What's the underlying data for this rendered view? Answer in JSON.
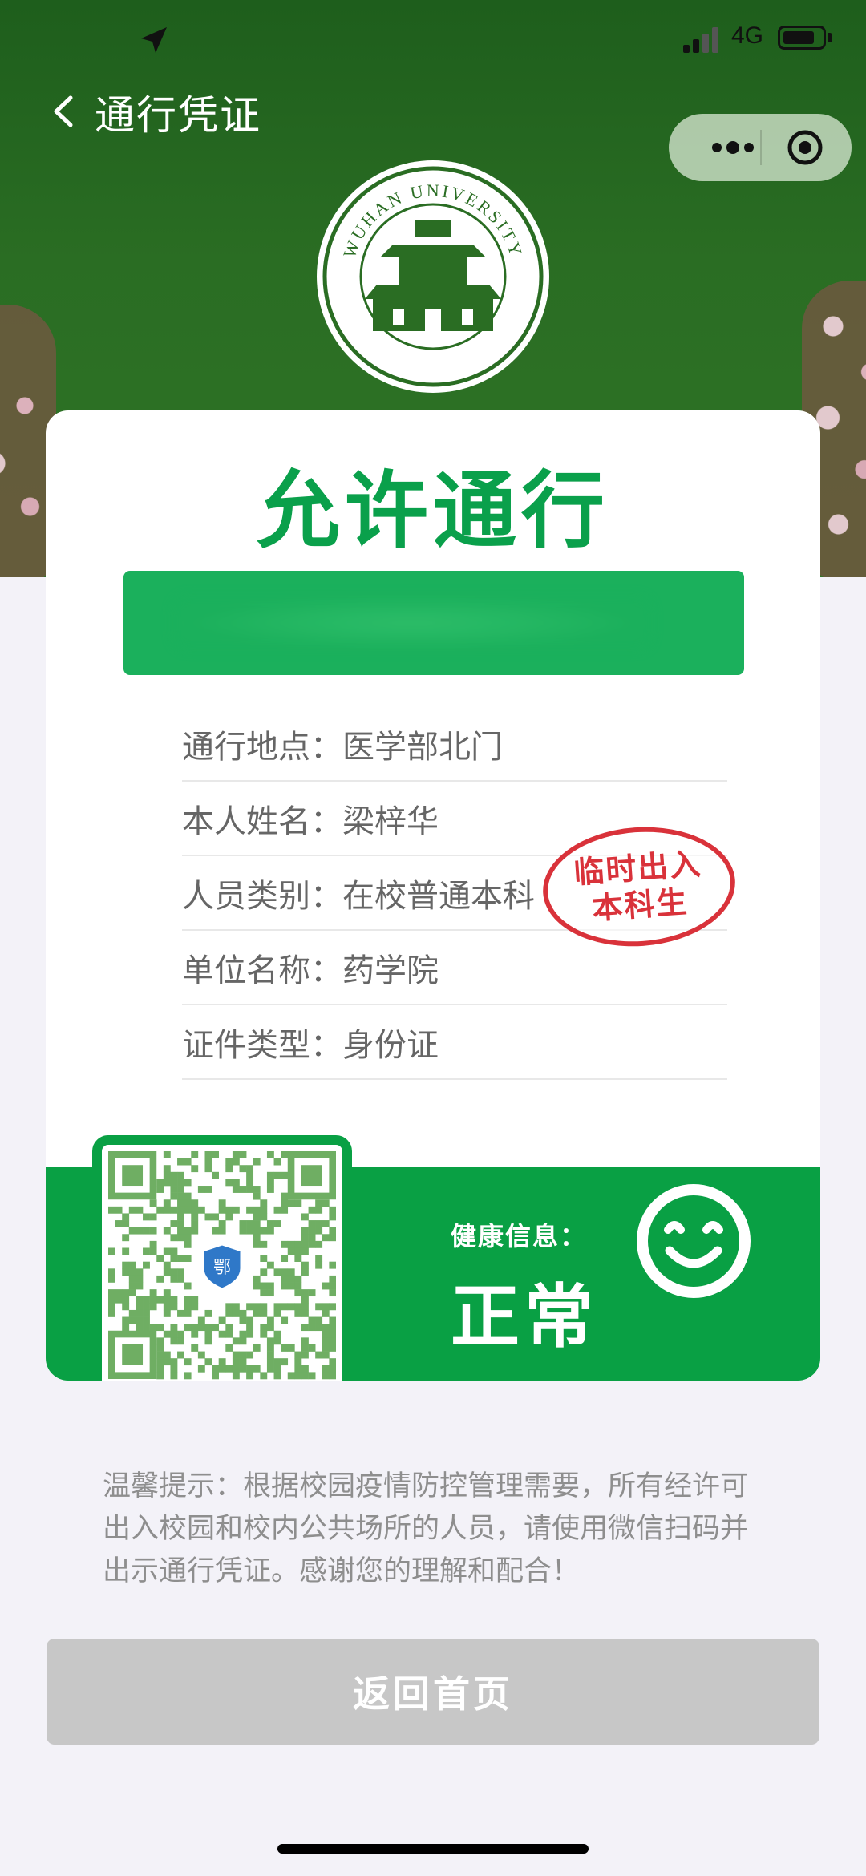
{
  "status_bar": {
    "network": "4G"
  },
  "nav": {
    "title": "通行凭证"
  },
  "logo": {
    "text": "WUHAN UNIVERSITY"
  },
  "card": {
    "title": "允许通行",
    "rows": [
      {
        "label": "通行地点：",
        "value": "医学部北门"
      },
      {
        "label": "本人姓名：",
        "value": "梁梓华"
      },
      {
        "label": "人员类别：",
        "value": "在校普通本科"
      },
      {
        "label": "单位名称：",
        "value": "药学院"
      },
      {
        "label": "证件类型：",
        "value": "身份证"
      }
    ],
    "stamp": {
      "line1": "临时出入",
      "line2": "本科生",
      "color": "#d9323a"
    },
    "health": {
      "label": "健康信息：",
      "value": "正常"
    },
    "qr_badge": "鄂"
  },
  "tip": "温馨提示：根据校园疫情防控管理需要，所有经许可出入校园和校内公共场所的人员，请使用微信扫码并出示通行凭证。感谢您的理解和配合！",
  "button": {
    "home": "返回首页"
  },
  "colors": {
    "primary_green": "#09a044",
    "header_green": "#2a6d23",
    "button_gray": "#c7c7c7"
  }
}
